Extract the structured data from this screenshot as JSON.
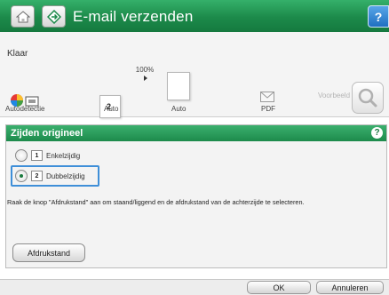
{
  "titlebar": {
    "title": "E-mail verzenden",
    "help_glyph": "?",
    "home_icon": "home-icon",
    "app_icon": "email-send-icon"
  },
  "status": {
    "text": "Klaar"
  },
  "options": {
    "color_label": "Autodetectie",
    "sides_label": "Auto",
    "sides_badge": "2",
    "scale_label": "Auto",
    "scale_percent": "100%",
    "filetype_label": "PDF",
    "preview_label": "Voorbeeld"
  },
  "panel": {
    "title": "Zijden origineel",
    "help_glyph": "?",
    "choices": [
      {
        "badge": "1",
        "label": "Enkelzijdig",
        "selected": false
      },
      {
        "badge": "2",
        "label": "Dubbelzijdig",
        "selected": true
      }
    ],
    "description": "Raak de knop \"Afdrukstand\" aan om staand/liggend en de afdrukstand van de achterzijde te selecteren.",
    "orientation_button": "Afdrukstand"
  },
  "footer": {
    "ok_label": "OK",
    "cancel_label": "Annuleren"
  },
  "colors": {
    "accent_green": "#1d8a4b",
    "help_blue": "#1f6fc1",
    "selection_blue": "#3f8fd8"
  }
}
